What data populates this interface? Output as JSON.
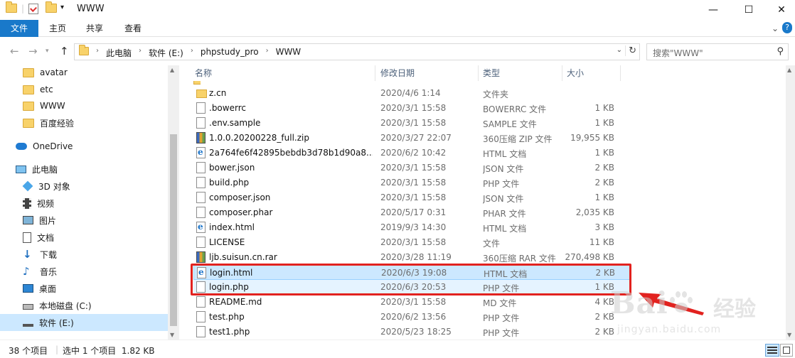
{
  "window": {
    "title": "WWW",
    "minimize": "—",
    "maximize": "☐",
    "close": "✕"
  },
  "ribbon": {
    "tabs": [
      "文件",
      "主页",
      "共享",
      "查看"
    ],
    "collapse": "⌄",
    "help": "?"
  },
  "address": {
    "crumbs": [
      "此电脑",
      "软件 (E:)",
      "phpstudy_pro",
      "WWW"
    ],
    "search_placeholder": "搜索\"WWW\""
  },
  "nav": {
    "folders": [
      "avatar",
      "etc",
      "WWW",
      "百度经验"
    ],
    "onedrive": "OneDrive",
    "this_pc": "此电脑",
    "pc_items": [
      "3D 对象",
      "视频",
      "图片",
      "文档",
      "下载",
      "音乐",
      "桌面",
      "本地磁盘 (C:)",
      "软件 (E:)"
    ]
  },
  "columns": {
    "name": "名称",
    "date": "修改日期",
    "type": "类型",
    "size": "大小"
  },
  "files": [
    {
      "name": "z.cn",
      "date": "2020/4/6 1:14",
      "type": "文件夹",
      "size": "",
      "icon": "folder"
    },
    {
      "name": ".bowerrc",
      "date": "2020/3/1 15:58",
      "type": "BOWERRC 文件",
      "size": "1 KB",
      "icon": "generic"
    },
    {
      "name": ".env.sample",
      "date": "2020/3/1 15:58",
      "type": "SAMPLE 文件",
      "size": "1 KB",
      "icon": "generic"
    },
    {
      "name": "1.0.0.20200228_full.zip",
      "date": "2020/3/27 22:07",
      "type": "360压缩 ZIP 文件",
      "size": "19,955 KB",
      "icon": "zip"
    },
    {
      "name": "2a764fe6f42895bebdb3d78b1d90a8...",
      "date": "2020/6/2 10:42",
      "type": "HTML 文档",
      "size": "1 KB",
      "icon": "html"
    },
    {
      "name": "bower.json",
      "date": "2020/3/1 15:58",
      "type": "JSON 文件",
      "size": "2 KB",
      "icon": "generic"
    },
    {
      "name": "build.php",
      "date": "2020/3/1 15:58",
      "type": "PHP 文件",
      "size": "2 KB",
      "icon": "generic"
    },
    {
      "name": "composer.json",
      "date": "2020/3/1 15:58",
      "type": "JSON 文件",
      "size": "1 KB",
      "icon": "generic"
    },
    {
      "name": "composer.phar",
      "date": "2020/5/17 0:31",
      "type": "PHAR 文件",
      "size": "2,035 KB",
      "icon": "generic"
    },
    {
      "name": "index.html",
      "date": "2019/9/3 14:30",
      "type": "HTML 文档",
      "size": "3 KB",
      "icon": "html"
    },
    {
      "name": "LICENSE",
      "date": "2020/3/1 15:58",
      "type": "文件",
      "size": "11 KB",
      "icon": "generic"
    },
    {
      "name": "ljb.suisun.cn.rar",
      "date": "2020/3/28 11:19",
      "type": "360压缩 RAR 文件",
      "size": "270,498 KB",
      "icon": "zip"
    },
    {
      "name": "login.html",
      "date": "2020/6/3 19:08",
      "type": "HTML 文档",
      "size": "2 KB",
      "icon": "html",
      "state": "selected"
    },
    {
      "name": "login.php",
      "date": "2020/6/3 20:53",
      "type": "PHP 文件",
      "size": "1 KB",
      "icon": "generic",
      "state": "hover"
    },
    {
      "name": "README.md",
      "date": "2020/3/1 15:58",
      "type": "MD 文件",
      "size": "4 KB",
      "icon": "generic"
    },
    {
      "name": "test.php",
      "date": "2020/6/2 13:56",
      "type": "PHP 文件",
      "size": "2 KB",
      "icon": "generic"
    },
    {
      "name": "test1.php",
      "date": "2020/5/23 18:25",
      "type": "PHP 文件",
      "size": "2 KB",
      "icon": "generic"
    }
  ],
  "status": {
    "count": "38 个项目",
    "selection": "选中 1 个项目  1.82 KB"
  },
  "watermark": {
    "brand": "Bai",
    "brand_cn": "经验",
    "url": "jingyan.baidu.com"
  },
  "colors": {
    "accent": "#1979ca",
    "selection": "#cce8ff",
    "annotation": "#e2221f"
  }
}
